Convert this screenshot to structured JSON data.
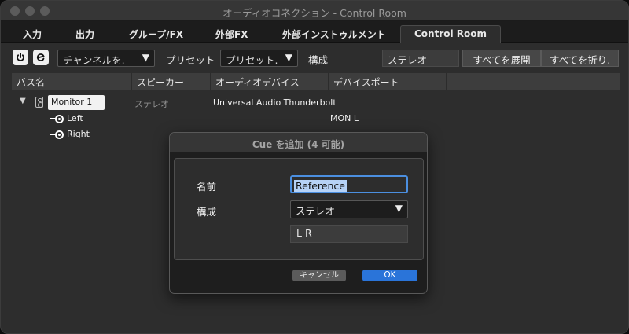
{
  "window": {
    "title": "オーディオコネクション - Control Room"
  },
  "tabs": [
    {
      "label": "入力"
    },
    {
      "label": "出力"
    },
    {
      "label": "グループ/FX"
    },
    {
      "label": "外部FX"
    },
    {
      "label": "外部インストゥルメント"
    },
    {
      "label": "Control Room",
      "active": true
    }
  ],
  "toolbar": {
    "channel_select": "チャンネルを.",
    "preset_label": "プリセット",
    "preset_select": "プリセット.",
    "config_label": "構成",
    "config_value": "ステレオ",
    "expand_all": "すべてを展開",
    "collapse_all": "すべてを折り."
  },
  "columns": [
    "バス名",
    "スピーカー",
    "オーディオデバイス",
    "デバイスポート"
  ],
  "tree": {
    "monitor": {
      "name": "Monitor 1",
      "speaker": "ステレオ",
      "device": "Universal Audio Thunderbolt"
    },
    "channels": [
      {
        "name": "Left",
        "port": "MON L"
      },
      {
        "name": "Right",
        "port": ""
      }
    ]
  },
  "dialog": {
    "title": "Cue を追加 (4 可能)",
    "name_label": "名前",
    "name_value": "Reference",
    "config_label": "構成",
    "config_value": "ステレオ",
    "channels_value": "L R",
    "cancel": "キャンセル",
    "ok": "OK"
  },
  "colors": {
    "accent": "#2a74d9",
    "selection": "#b6d2f6",
    "background": "#2d2d2d"
  }
}
